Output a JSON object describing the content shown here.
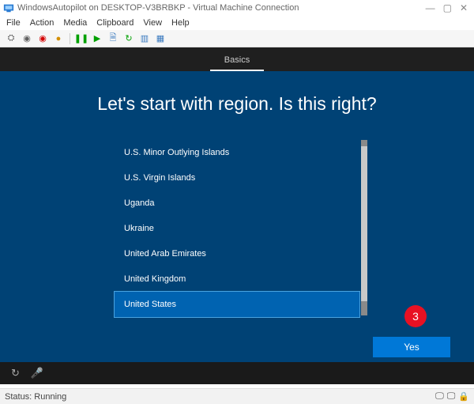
{
  "window": {
    "title": "WindowsAutopilot on DESKTOP-V3BRBKP - Virtual Machine Connection",
    "controls": {
      "min": "—",
      "max": "▢",
      "close": "✕"
    }
  },
  "menu": {
    "items": [
      "File",
      "Action",
      "Media",
      "Clipboard",
      "View",
      "Help"
    ]
  },
  "toolbar": {
    "buttons": [
      {
        "name": "settings-icon",
        "glyph": "⛭",
        "color": "#606060"
      },
      {
        "name": "ctrl-alt-del-icon",
        "glyph": "◉",
        "color": "#606060"
      },
      {
        "name": "record-icon",
        "glyph": "◉",
        "color": "#d40000"
      },
      {
        "name": "stop-icon",
        "glyph": "●",
        "color": "#d48f00"
      },
      {
        "sep": true
      },
      {
        "name": "pause-icon",
        "glyph": "❚❚",
        "color": "#00a000"
      },
      {
        "name": "play-icon",
        "glyph": "▶",
        "color": "#00a000"
      },
      {
        "name": "checkpoint-icon",
        "glyph": "🗎",
        "color": "#3a7abf"
      },
      {
        "name": "revert-icon",
        "glyph": "↻",
        "color": "#00a000"
      },
      {
        "name": "enhanced-icon",
        "glyph": "▥",
        "color": "#3a7abf"
      },
      {
        "name": "share-icon",
        "glyph": "▦",
        "color": "#3a7abf"
      }
    ]
  },
  "oobe": {
    "tab": "Basics",
    "heading": "Let's start with region. Is this right?",
    "regions": [
      "U.S. Minor Outlying Islands",
      "U.S. Virgin Islands",
      "Uganda",
      "Ukraine",
      "United Arab Emirates",
      "United Kingdom",
      "United States"
    ],
    "selected_index": 6,
    "yes_label": "Yes",
    "step_badge": "3"
  },
  "bottombar": {
    "accessibility_glyph": "↻",
    "mic_glyph": "🎤"
  },
  "status": {
    "text": "Status: Running",
    "icons": {
      "a": "🖵",
      "b": "🖵",
      "c": "🔒"
    }
  }
}
